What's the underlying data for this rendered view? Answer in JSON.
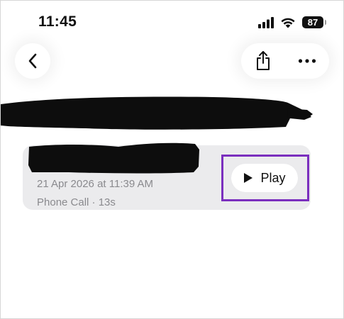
{
  "status_bar": {
    "time": "11:45",
    "battery_level": "87",
    "signal_icon": "cellular-signal-icon",
    "wifi_icon": "wifi-icon"
  },
  "navigation": {
    "back_icon": "chevron-left-icon",
    "share_icon": "share-icon",
    "more_icon": "ellipsis-icon"
  },
  "recording": {
    "date": "21 Apr 2026 at 11:39 AM",
    "meta": "Phone Call · 13s",
    "play_label": "Play",
    "play_icon": "play-icon"
  },
  "colors": {
    "highlight": "#7b2fbe",
    "card_background": "#ebebed",
    "secondary_text": "#8a8a8e"
  }
}
